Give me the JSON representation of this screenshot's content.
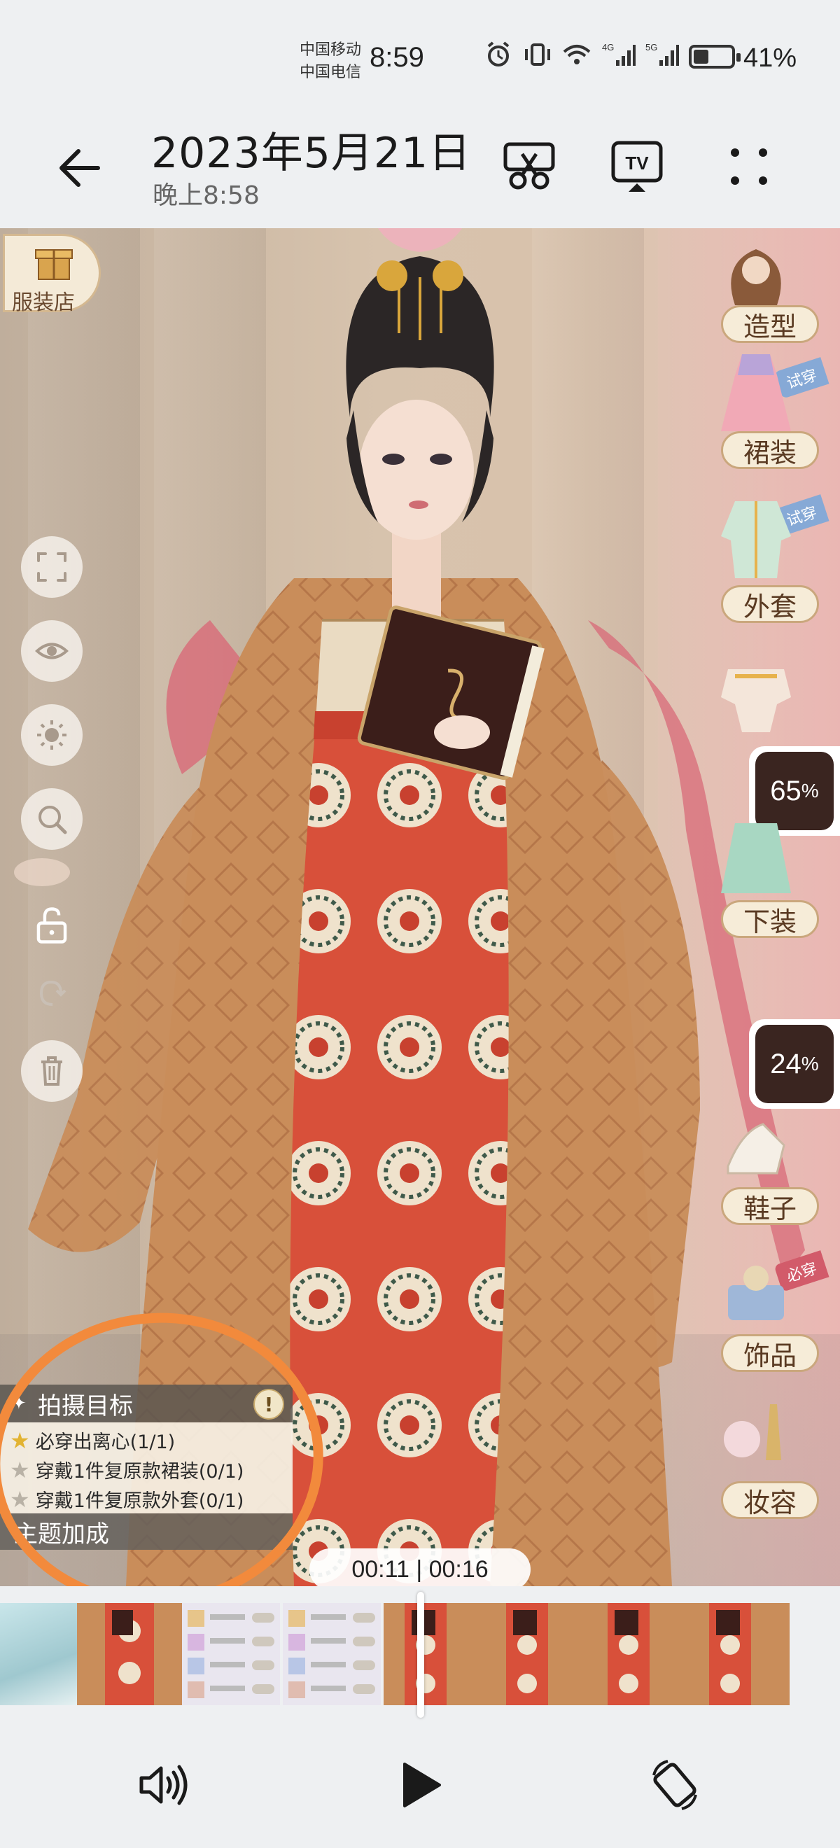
{
  "status_bar": {
    "carrier_1": "中国移动",
    "carrier_2": "中国电信",
    "time": "8:59",
    "signal_1": "4G",
    "signal_2": "5G",
    "battery_percent": "41%",
    "battery_level": 0.41
  },
  "header": {
    "title": "2023年5月21日",
    "subtitle": "晚上8:58",
    "icons": [
      "back-arrow-icon",
      "cut-icon",
      "tv-cast-icon",
      "more-icon"
    ]
  },
  "viewer": {
    "shop_label": "服装店",
    "left_tools": [
      "fullscreen-icon",
      "eye-icon",
      "brightness-icon",
      "zoom-icon",
      "unlock-icon",
      "redo-icon",
      "trash-icon"
    ],
    "categories": [
      {
        "label": "造型",
        "tag": ""
      },
      {
        "label": "裙装",
        "tag": "试穿"
      },
      {
        "label": "外套",
        "tag": "试穿"
      },
      {
        "label": "下装",
        "tag": ""
      },
      {
        "label": "鞋子",
        "tag": ""
      },
      {
        "label": "饰品",
        "tag": "必穿"
      },
      {
        "label": "妆容",
        "tag": ""
      }
    ],
    "progress_badges": [
      {
        "value": "65",
        "unit": "%"
      },
      {
        "value": "24",
        "unit": "%"
      }
    ],
    "objectives": {
      "title": "拍摄目标",
      "alert": "!",
      "items": [
        {
          "text": "必穿出离心(1/1)",
          "done": true
        },
        {
          "text": "穿戴1件复原款裙装(0/1)",
          "done": false
        },
        {
          "text": "穿戴1件复原款外套(0/1)",
          "done": false
        }
      ],
      "bonus_title": "主题加成"
    },
    "timecode": "00:11 | 00:16"
  },
  "playback": {
    "current": "00:11",
    "total": "00:16",
    "progress": 0.6875
  },
  "controls": [
    "volume-icon",
    "play-icon",
    "rotate-screen-icon"
  ],
  "colors": {
    "annotation": "#f28a3c",
    "accent_tag_try": "#86a9d6",
    "accent_tag_must": "#d25b6a",
    "dress_red": "#d8503a",
    "robe_tan": "#c98d5a"
  }
}
